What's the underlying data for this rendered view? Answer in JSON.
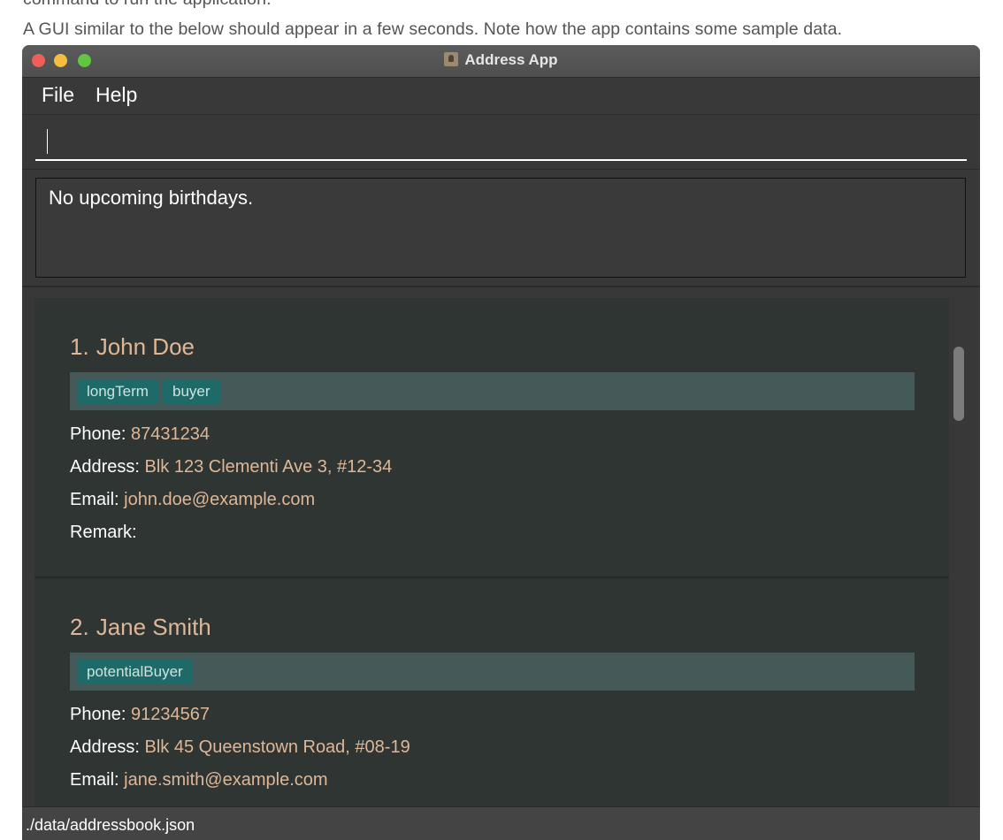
{
  "doc": {
    "line1": "command to run the application.",
    "line2": "A GUI similar to the below should appear in a few seconds. Note how the app contains some sample data."
  },
  "window": {
    "title": "Address App",
    "traffic_colors": [
      "#ee5f57",
      "#f4bd3e",
      "#5fc840"
    ]
  },
  "menu": {
    "file": "File",
    "help": "Help"
  },
  "command": {
    "value": ""
  },
  "result": {
    "text": "No upcoming birthdays."
  },
  "persons": [
    {
      "index": "1.",
      "name": "John Doe",
      "tags": [
        "longTerm",
        "buyer"
      ],
      "phone_label": "Phone:",
      "phone": "87431234",
      "address_label": "Address:",
      "address": "Blk 123 Clementi Ave 3, #12-34",
      "email_label": "Email:",
      "email": "john.doe@example.com",
      "remark_label": "Remark:",
      "remark": ""
    },
    {
      "index": "2.",
      "name": "Jane Smith",
      "tags": [
        "potentialBuyer"
      ],
      "phone_label": "Phone:",
      "phone": "91234567",
      "address_label": "Address:",
      "address": "Blk 45 Queenstown Road, #08-19",
      "email_label": "Email:",
      "email": "jane.smith@example.com"
    }
  ],
  "status": {
    "path": "./data/addressbook.json"
  },
  "colors": {
    "accent": "#dfb797",
    "tag_bg": "#1e6a68",
    "tag_bar": "#455a58",
    "card_bg": "#2e3532",
    "window_bg": "#383838"
  },
  "icons": {
    "app": "address-book-icon"
  }
}
